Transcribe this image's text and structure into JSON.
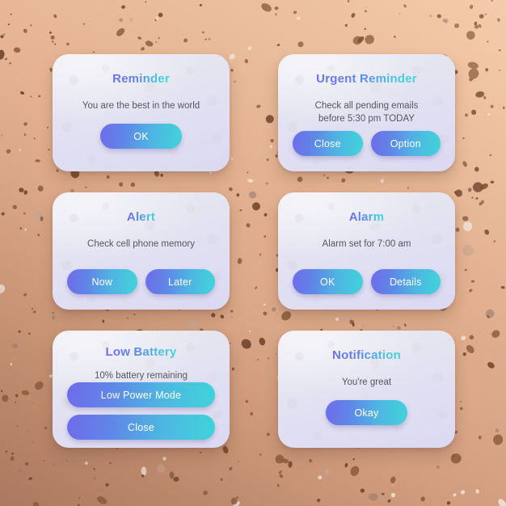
{
  "background": {
    "style": "terrazzo-speckle",
    "gradient_from": "#f2c9a8",
    "gradient_to": "#b8856c",
    "speckle_colors": [
      "#8a5a3c",
      "#6d4229",
      "#a08070",
      "#f5ece2",
      "#c9a893"
    ]
  },
  "theme": {
    "accent_gradient_start": "#6f6ce9",
    "accent_gradient_end": "#3fd4da",
    "card_background": "#e5e5f1",
    "body_text_color": "#565660",
    "button_text_color": "#ffffff"
  },
  "cards": [
    {
      "id": "reminder",
      "title": "Reminder",
      "body": "You are the best in the world",
      "layout": "single",
      "buttons": [
        {
          "label": "OK",
          "name": "ok-button"
        }
      ]
    },
    {
      "id": "urgent-reminder",
      "title": "Urgent Reminder",
      "body": "Check all pending emails\nbefore 5:30 pm TODAY",
      "layout": "two",
      "buttons": [
        {
          "label": "Close",
          "name": "close-button"
        },
        {
          "label": "Option",
          "name": "option-button"
        }
      ]
    },
    {
      "id": "alert",
      "title": "Alert",
      "body": "Check cell phone memory",
      "layout": "two",
      "buttons": [
        {
          "label": "Now",
          "name": "now-button"
        },
        {
          "label": "Later",
          "name": "later-button"
        }
      ]
    },
    {
      "id": "alarm",
      "title": "Alarm",
      "body": "Alarm set for 7:00 am",
      "layout": "two",
      "buttons": [
        {
          "label": "OK",
          "name": "ok-button"
        },
        {
          "label": "Details",
          "name": "details-button"
        }
      ]
    },
    {
      "id": "low-battery",
      "title": "Low Battery",
      "body": "10% battery remaining",
      "layout": "stack",
      "buttons": [
        {
          "label": "Low Power Mode",
          "name": "low-power-mode-button"
        },
        {
          "label": "Close",
          "name": "close-button"
        }
      ]
    },
    {
      "id": "notification",
      "title": "Notification",
      "body": "You're great",
      "layout": "single",
      "buttons": [
        {
          "label": "Okay",
          "name": "okay-button"
        }
      ]
    }
  ]
}
